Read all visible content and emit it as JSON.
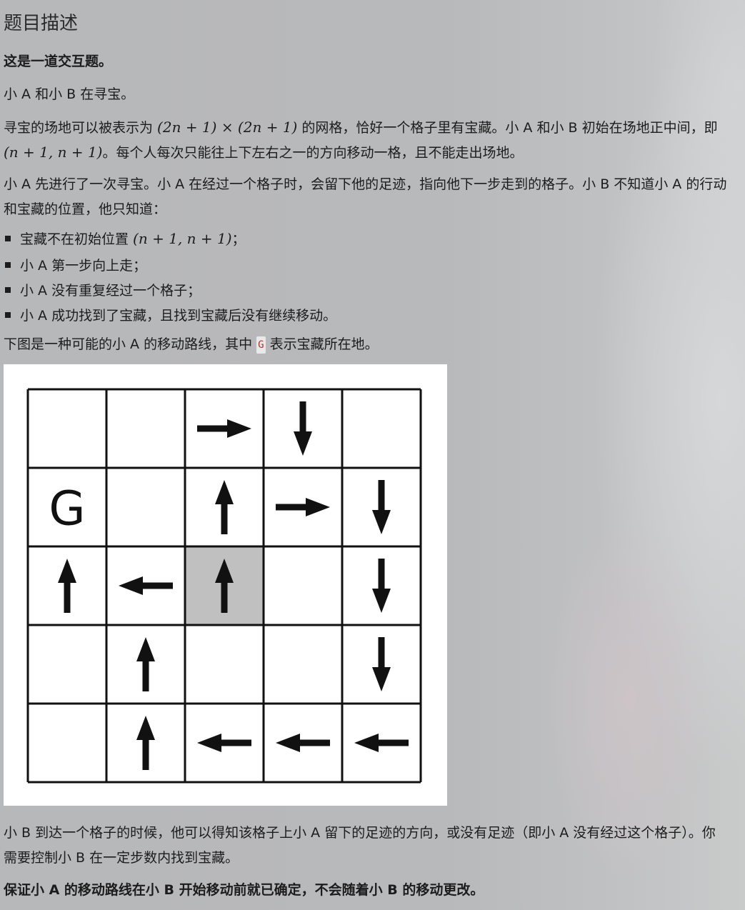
{
  "title": "题目描述",
  "intro_bold": "这是一道交互题。",
  "p1": "小 A 和小 B 在寻宝。",
  "p2": {
    "line1_a": "寻宝的场地可以被表示为 ",
    "math_size1": "(2n + 1) × (2n + 1)",
    "line1_b": " 的网格，恰好一个格子里有宝藏。小 A 和小 B 初始在场地正中间，即",
    "math_start": "(n + 1, n + 1)",
    "line2_b": "。每个人每次只能往上下左右之一的方向移动一格，且不能走出场地。"
  },
  "p3": {
    "line1": "小 A 先进行了一次寻宝。小 A 在经过一个格子时，会留下他的足迹，指向他下一步走到的格子。小 B 不知道小 A 的行动",
    "line2": "和宝藏的位置，他只知道："
  },
  "bullets": {
    "b1_text": "宝藏不在初始位置 ",
    "b1_math": "(n + 1, n + 1)",
    "b1_end": "；",
    "b2": "小 A 第一步向上走；",
    "b3": "小 A 没有重复经过一个格子；",
    "b4": "小 A 成功找到了宝藏，且找到宝藏后没有继续移动。"
  },
  "figure_caption": {
    "before": "下图是一种可能的小 A 的移动路线，其中 ",
    "code": "G",
    "after": " 表示宝藏所在地。"
  },
  "grid": {
    "size": 5,
    "goal_label": "G",
    "start_fill": "#c0c0c0",
    "cells": [
      [
        "",
        "",
        "right",
        "down",
        ""
      ],
      [
        "G",
        "",
        "up",
        "right",
        "down"
      ],
      [
        "up",
        "left",
        "up",
        "",
        "down"
      ],
      [
        "",
        "up",
        "",
        "",
        "down"
      ],
      [
        "",
        "up",
        "left",
        "left",
        "left"
      ]
    ],
    "start_cell": [
      2,
      2
    ]
  },
  "p4": {
    "line1": "小 B 到达一个格子的时候，他可以得知该格子上小 A 留下的足迹的方向，或没有足迹（即小 A 没有经过这个格子）。你",
    "line2": "需要控制小 B 在一定步数内找到宝藏。"
  },
  "final_bold": "保证小 A 的移动路线在小 B 开始移动前就已确定，不会随着小 B 的移动更改。"
}
